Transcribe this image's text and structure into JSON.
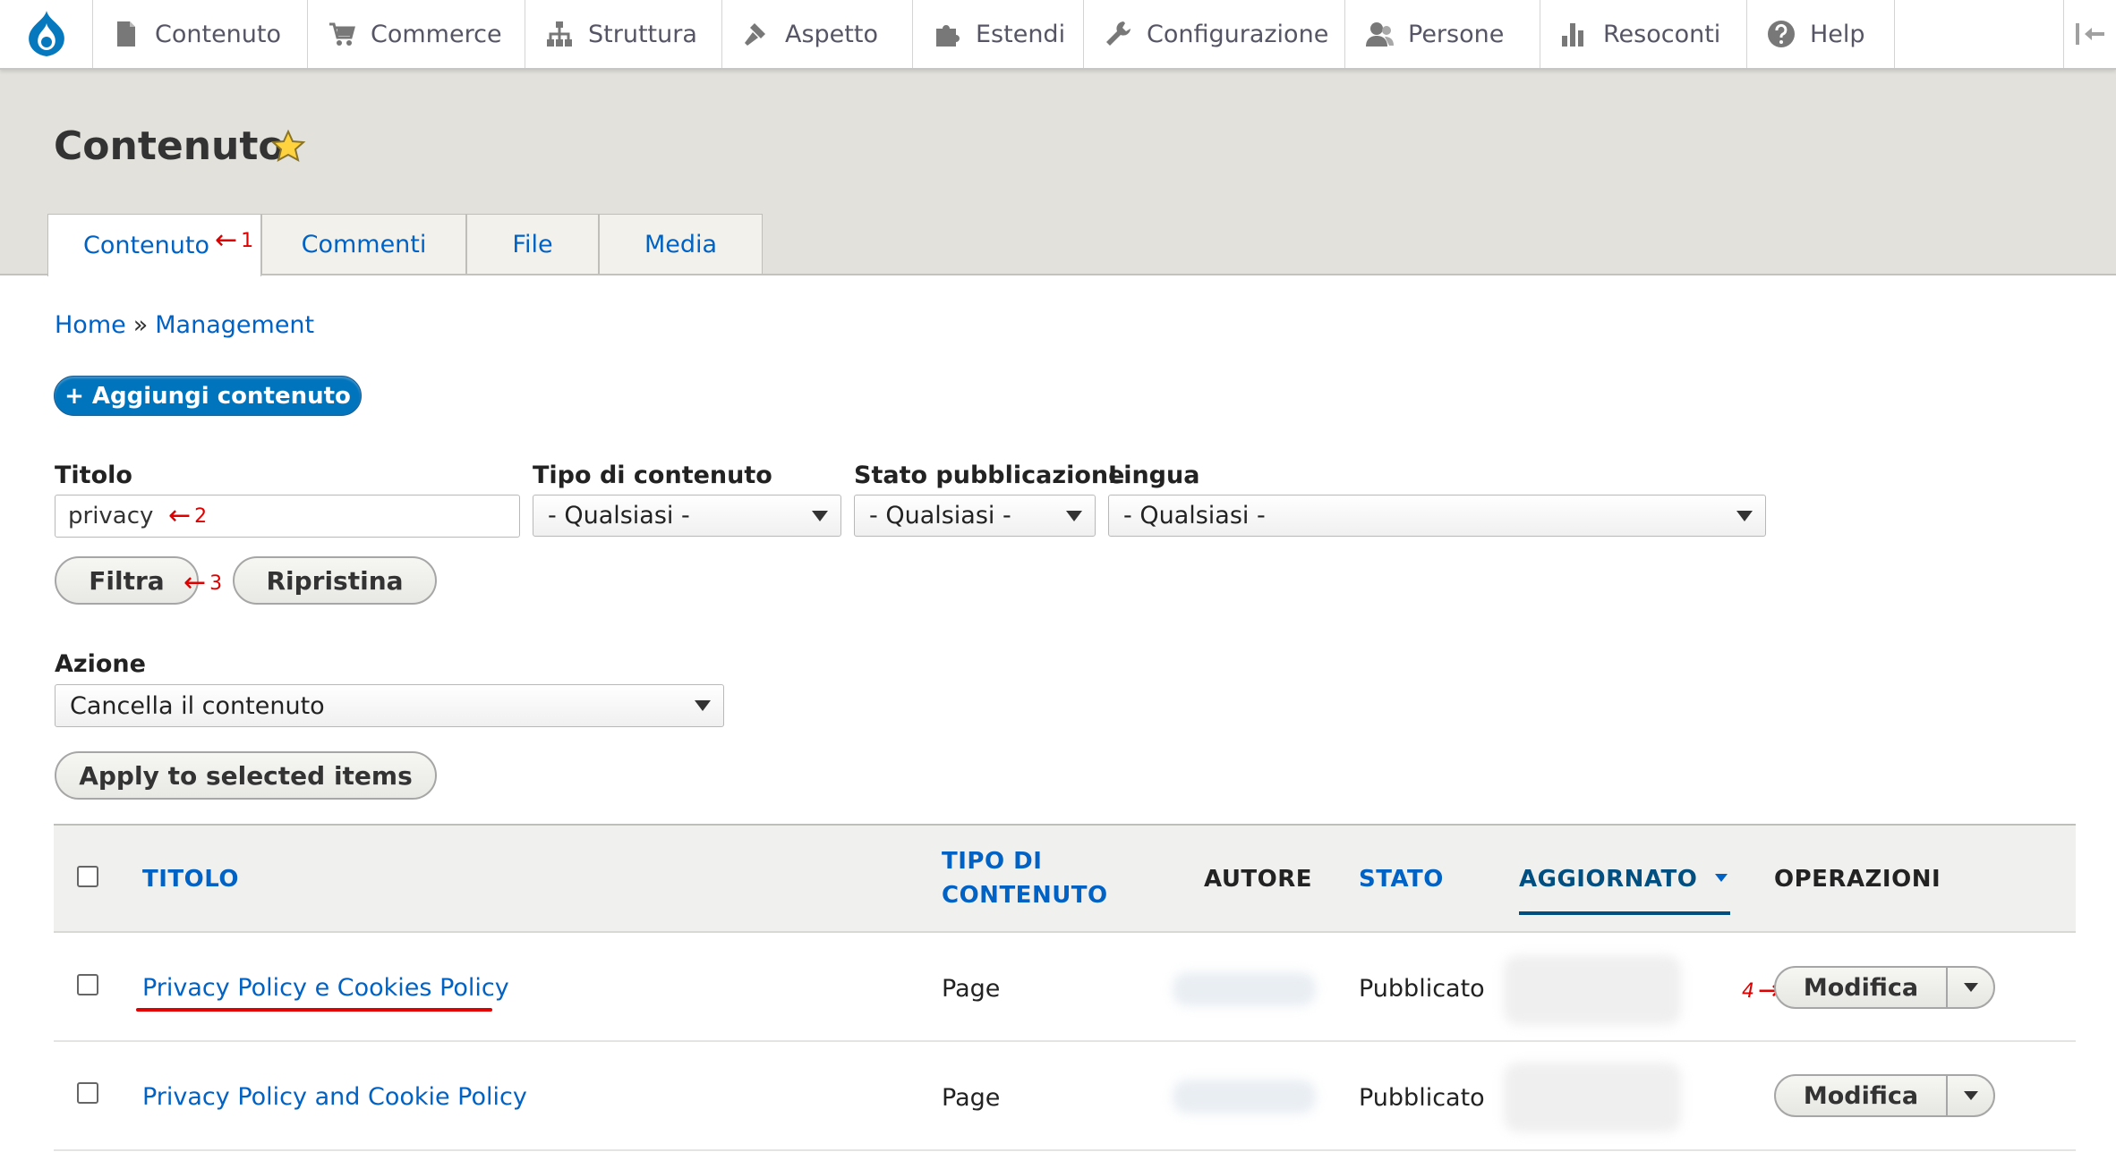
{
  "toolbar": {
    "items": [
      {
        "label": "Contenuto",
        "icon": "file-icon"
      },
      {
        "label": "Commerce",
        "icon": "cart-icon"
      },
      {
        "label": "Struttura",
        "icon": "sitemap-icon"
      },
      {
        "label": "Aspetto",
        "icon": "paint-icon"
      },
      {
        "label": "Estendi",
        "icon": "puzzle-icon"
      },
      {
        "label": "Configurazione",
        "icon": "wrench-icon"
      },
      {
        "label": "Persone",
        "icon": "people-icon"
      },
      {
        "label": "Resoconti",
        "icon": "bars-icon"
      },
      {
        "label": "Help",
        "icon": "help-icon"
      }
    ]
  },
  "page": {
    "title": "Contenuto",
    "tabs": [
      "Contenuto",
      "Commenti",
      "File",
      "Media"
    ],
    "active_tab": "Contenuto"
  },
  "breadcrumb": {
    "home": "Home",
    "separator": "»",
    "current": "Management"
  },
  "add_button": "+ Aggiungi contenuto",
  "filters": {
    "title_label": "Titolo",
    "title_value": "privacy",
    "type_label": "Tipo di contenuto",
    "type_value": "- Qualsiasi -",
    "status_label": "Stato pubblicazione",
    "status_value": "- Qualsiasi -",
    "lang_label": "Lingua",
    "lang_value": "- Qualsiasi -",
    "filter_button": "Filtra",
    "reset_button": "Ripristina"
  },
  "action": {
    "label": "Azione",
    "value": "Cancella il contenuto",
    "apply_button": "Apply to selected items"
  },
  "annotations": {
    "a1": "1",
    "a2": "2",
    "a3": "3",
    "a4": "4"
  },
  "table": {
    "headers": {
      "title": "TITOLO",
      "type_line1": "TIPO DI",
      "type_line2": "CONTENUTO",
      "author": "AUTORE",
      "status": "STATO",
      "updated": "AGGIORNATO",
      "operations": "OPERAZIONI"
    },
    "rows": [
      {
        "title": "Privacy Policy e Cookies Policy",
        "type": "Page",
        "status": "Pubblicato",
        "operation": "Modifica"
      },
      {
        "title": "Privacy Policy and Cookie Policy",
        "type": "Page",
        "status": "Pubblicato",
        "operation": "Modifica"
      }
    ]
  },
  "colors": {
    "link": "#0062c4",
    "primary_button": "#0074bd",
    "annotation": "#e00000",
    "header_bg": "#e2e1db"
  }
}
